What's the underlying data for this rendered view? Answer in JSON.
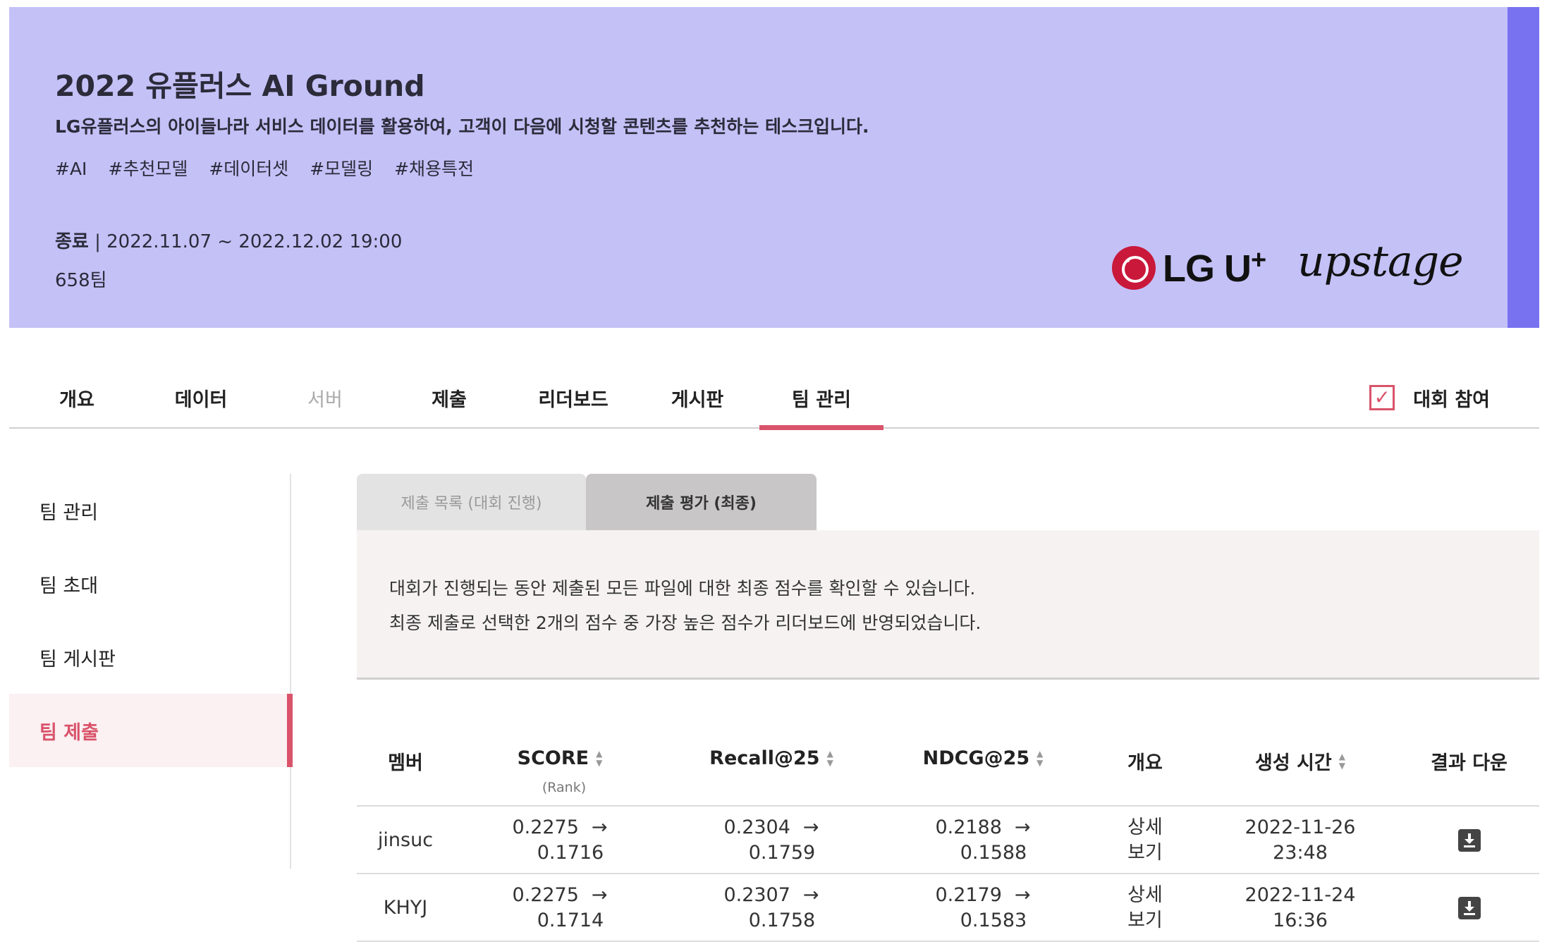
{
  "banner": {
    "title": "2022 유플러스 AI Ground",
    "subtitle": "LG유플러스의 아이들나라 서비스 데이터를 활용하여, 고객이 다음에 시청할 콘텐츠를 추천하는 테스크입니다.",
    "tags": [
      "#AI",
      "#추천모델",
      "#데이터셋",
      "#모델링",
      "#채용특전"
    ],
    "status_label": "종료",
    "period": " | 2022.11.07 ~ 2022.12.02 19:00",
    "teams": "658팀",
    "logo_lg": "LG U",
    "logo_lg_plus": "+",
    "logo_upstage": "upstage",
    "background_color": "#c4c1f7",
    "stripe_color": "#7872f0"
  },
  "nav": {
    "tabs": [
      {
        "label": "개요",
        "state": "normal"
      },
      {
        "label": "데이터",
        "state": "normal"
      },
      {
        "label": "서버",
        "state": "disabled"
      },
      {
        "label": "제출",
        "state": "normal"
      },
      {
        "label": "리더보드",
        "state": "normal"
      },
      {
        "label": "게시판",
        "state": "normal"
      },
      {
        "label": "팀 관리",
        "state": "active"
      }
    ],
    "join_label": "대회 참여",
    "join_checked": "✓",
    "accent_color": "#d9536a"
  },
  "sidebar": {
    "items": [
      {
        "label": "팀 관리"
      },
      {
        "label": "팀 초대"
      },
      {
        "label": "팀 게시판"
      },
      {
        "label": "팀 제출",
        "active": true
      }
    ]
  },
  "subtabs": {
    "list": "제출 목록 (대회 진행)",
    "eval": "제출 평가 (최종)"
  },
  "info": {
    "line1": "대회가 진행되는 동안 제출된 모든 파일에 대한 최종 점수를 확인할 수 있습니다.",
    "line2": "최종 제출로 선택한 2개의 점수 중 가장 높은 점수가 리더보드에 반영되었습니다."
  },
  "table": {
    "headers": {
      "member": "멤버",
      "score": "SCORE",
      "score_sub": "(Rank)",
      "recall": "Recall@25",
      "ndcg": "NDCG@25",
      "summary": "개요",
      "created": "생성 시간",
      "download": "결과 다운"
    },
    "arrow": "→",
    "rows": [
      {
        "member": "jinsuc",
        "score_from": "0.2275",
        "score_to": "0.1716",
        "recall_from": "0.2304",
        "recall_to": "0.1759",
        "ndcg_from": "0.2188",
        "ndcg_to": "0.1588",
        "summary_1": "상세",
        "summary_2": "보기",
        "date": "2022-11-26",
        "time": "23:48"
      },
      {
        "member": "KHYJ",
        "score_from": "0.2275",
        "score_to": "0.1714",
        "recall_from": "0.2307",
        "recall_to": "0.1758",
        "ndcg_from": "0.2179",
        "ndcg_to": "0.1583",
        "summary_1": "상세",
        "summary_2": "보기",
        "date": "2022-11-24",
        "time": "16:36"
      }
    ]
  }
}
